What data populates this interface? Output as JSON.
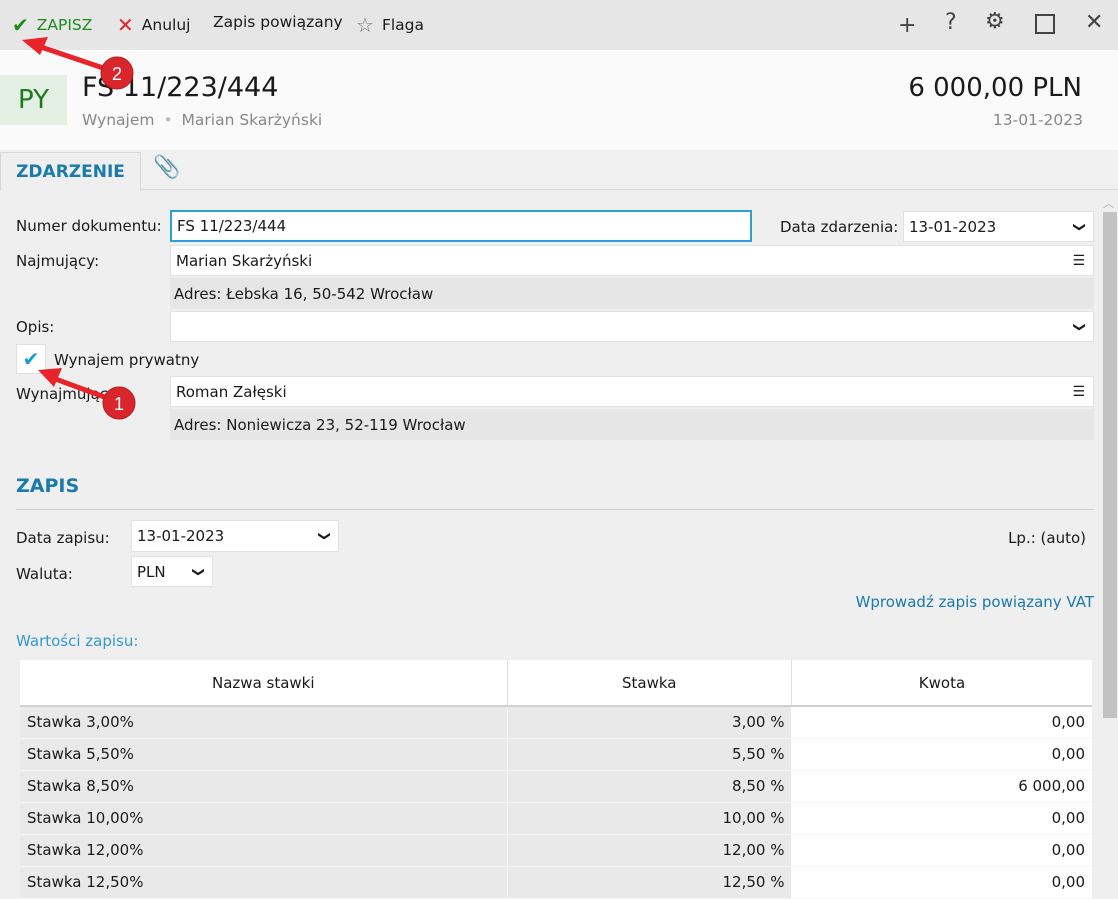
{
  "toolbar": {
    "save": "ZAPISZ",
    "cancel": "Anuluj",
    "linked": "Zapis powiązany",
    "flag": "Flaga"
  },
  "header": {
    "avatar": "PY",
    "title": "FS 11/223/444",
    "subtitle_type": "Wynajem",
    "subtitle_sep": "•",
    "subtitle_person": "Marian Skarżyński",
    "amount": "6 000,00 PLN",
    "date": "13-01-2023"
  },
  "tabs": {
    "event": "ZDARZENIE"
  },
  "form": {
    "doc_number_label": "Numer dokumentu:",
    "doc_number": "FS 11/223/444",
    "event_date_label": "Data zdarzenia:",
    "event_date": "13-01-2023",
    "tenant_label": "Najmujący:",
    "tenant": "Marian Skarżyński",
    "tenant_address": "Adres:  Łebska 16, 50-542 Wrocław",
    "desc_label": "Opis:",
    "desc": "",
    "private_label": "Wynajem prywatny",
    "private_checked": true,
    "landlord_label": "Wynajmujący:",
    "landlord": "Roman Załęski",
    "landlord_address": "Adres:  Noniewicza 23, 52-119 Wrocław"
  },
  "entry": {
    "heading": "ZAPIS",
    "date_label": "Data zapisu:",
    "date": "13-01-2023",
    "currency_label": "Waluta:",
    "currency": "PLN",
    "lp": "Lp.:  (auto)",
    "vat_link": "Wprowadź zapis powiązany VAT",
    "values_label": "Wartości zapisu:"
  },
  "table": {
    "headers": [
      "Nazwa stawki",
      "Stawka",
      "Kwota"
    ],
    "rows": [
      [
        "Stawka 3,00%",
        "3,00 %",
        "0,00"
      ],
      [
        "Stawka 5,50%",
        "5,50 %",
        "0,00"
      ],
      [
        "Stawka 8,50%",
        "8,50 %",
        "6 000,00"
      ],
      [
        "Stawka 10,00%",
        "10,00 %",
        "0,00"
      ],
      [
        "Stawka 12,00%",
        "12,00 %",
        "0,00"
      ],
      [
        "Stawka 12,50%",
        "12,50 %",
        "0,00"
      ]
    ]
  },
  "annotations": {
    "a1": "1",
    "a2": "2"
  },
  "colors": {
    "accent": "#1a7aaa",
    "save": "#1d8a1d",
    "cancel": "#e0242c",
    "annotation": "#e8242a"
  }
}
